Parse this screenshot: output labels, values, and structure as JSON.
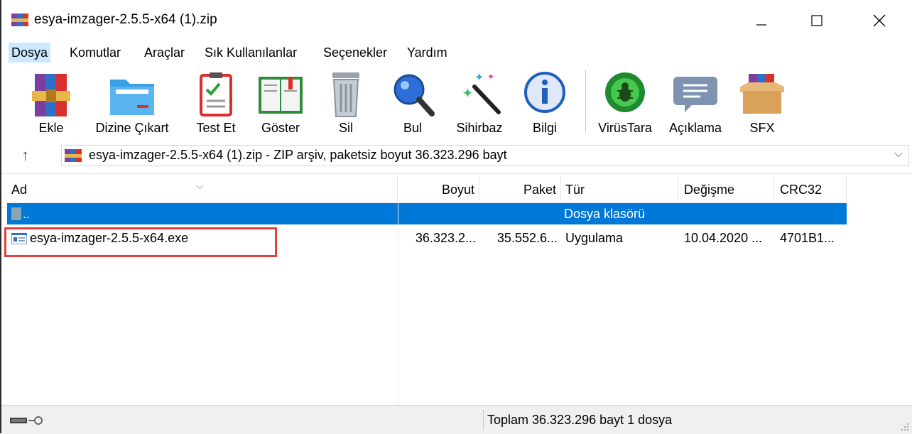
{
  "window": {
    "title": "esya-imzager-2.5.5-x64 (1).zip",
    "minimize_glyph": "—",
    "maximize_glyph": "☐",
    "close_glyph": "✕"
  },
  "menu": [
    "Dosya",
    "Komutlar",
    "Araçlar",
    "Sık Kullanılanlar",
    "Seçenekler",
    "Yardım"
  ],
  "toolbar": [
    {
      "label": "Ekle",
      "icon": "archive-add-icon"
    },
    {
      "label": "Dizine Çıkart",
      "icon": "folder-extract-icon"
    },
    {
      "label": "Test Et",
      "icon": "clipboard-check-icon"
    },
    {
      "label": "Göster",
      "icon": "book-view-icon"
    },
    {
      "label": "Sil",
      "icon": "trash-icon"
    },
    {
      "label": "Bul",
      "icon": "magnifier-icon"
    },
    {
      "label": "Sihirbaz",
      "icon": "wizard-wand-icon"
    },
    {
      "label": "Bilgi",
      "icon": "info-icon"
    },
    {
      "label": "VirüsTara",
      "icon": "virus-scan-icon"
    },
    {
      "label": "Açıklama",
      "icon": "comment-icon"
    },
    {
      "label": "SFX",
      "icon": "sfx-box-icon"
    }
  ],
  "address": {
    "up_glyph": "↑",
    "path": "esya-imzager-2.5.5-x64 (1).zip - ZIP arşiv, paketsiz boyut 36.323.296 bayt",
    "dropdown_glyph": "⌵"
  },
  "columns": [
    "Ad",
    "Boyut",
    "Paket",
    "Tür",
    "Değişme",
    "CRC32"
  ],
  "sort_indicator": "⌵",
  "rows": [
    {
      "name": "..",
      "size": "",
      "packed": "",
      "type": "Dosya klasörü",
      "modified": "",
      "crc": ""
    },
    {
      "name": "esya-imzager-2.5.5-x64.exe",
      "size": "36.323.2...",
      "packed": "35.552.6...",
      "type": "Uygulama",
      "modified": "10.04.2020 ...",
      "crc": "4701B1..."
    }
  ],
  "status": {
    "text": "Toplam 36.323.296 bayt 1 dosya"
  },
  "colors": {
    "selection": "#0078d7",
    "highlight_box": "#e04040",
    "menu_active": "#cce8ff"
  }
}
